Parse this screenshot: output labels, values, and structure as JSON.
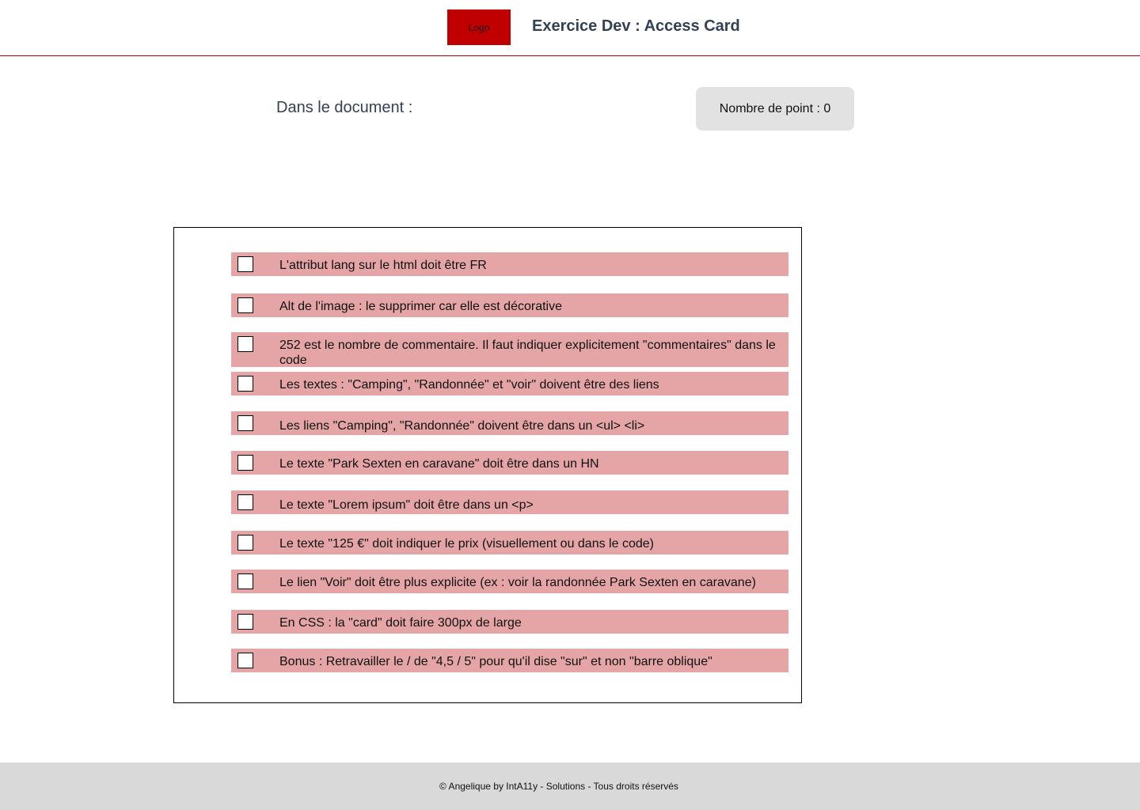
{
  "header": {
    "logo_text": "Logo",
    "title": "Exercice Dev : Access Card"
  },
  "main": {
    "document_label": "Dans le document :",
    "points_label": "Nombre de point : 0",
    "checklist": [
      {
        "label": "L'attribut lang sur le html doit être FR",
        "checked": false
      },
      {
        "label": "Alt de l'image : le supprimer car elle est décorative",
        "checked": false
      },
      {
        "label": "252 est le nombre de commentaire. Il faut indiquer explicitement \"commentaires\" dans le code",
        "checked": false
      },
      {
        "label": "Les textes : \"Camping\", \"Randonnée\" et \"voir\" doivent être des liens",
        "checked": false
      },
      {
        "label": "Les liens \"Camping\", \"Randonnée\" doivent être dans un <ul> <li>",
        "checked": false
      },
      {
        "label": "Le texte \"Park Sexten en caravane\" doit être dans un HN",
        "checked": false
      },
      {
        "label": "Le texte \"Lorem ipsum\" doit être dans un <p>",
        "checked": false
      },
      {
        "label": "Le texte \"125 €\" doit indiquer le prix (visuellement ou dans le code)",
        "checked": false
      },
      {
        "label": "Le lien \"Voir\" doit être plus explicite (ex : voir la randonnée Park Sexten en caravane)",
        "checked": false
      },
      {
        "label": "En CSS : la \"card\" doit faire 300px de large",
        "checked": false
      },
      {
        "label": "Bonus : Retravailler le / de \"4,5 / 5\" pour qu'il dise \"sur\" et non \"barre oblique\"",
        "checked": false
      }
    ]
  },
  "footer": {
    "text": "© Angelique by IntA11y - Solutions - Tous droits réservés"
  },
  "colors": {
    "brand_red": "#c00000",
    "row_background": "#e5a5a6",
    "badge_background": "#e2e2e2",
    "footer_background": "#d9d9d9",
    "title_text": "#334155"
  }
}
